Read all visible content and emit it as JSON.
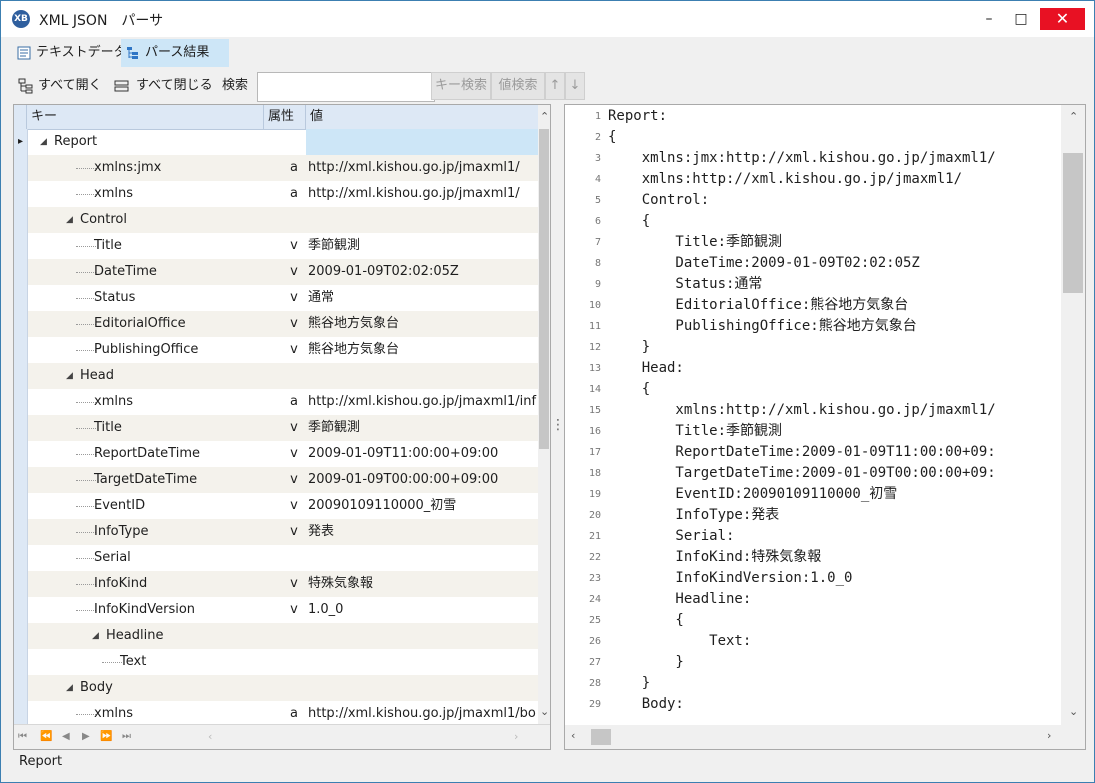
{
  "window": {
    "icon_text": "XB",
    "title": "XML JSON　パーサ",
    "minimize": "–",
    "maximize": "□",
    "close": "✕"
  },
  "tabs": [
    {
      "label": "テキストデータ",
      "icon": "document-icon",
      "selected": false
    },
    {
      "label": "パース結果",
      "icon": "tree-icon",
      "selected": true
    }
  ],
  "toolbar": {
    "expand_all": "すべて開く",
    "collapse_all": "すべて閉じる",
    "search_label": "検索",
    "search_value": "",
    "key_search": "キー検索",
    "value_search": "値検索",
    "up": "↑",
    "down": "↓"
  },
  "grid": {
    "columns": [
      "キー",
      "属性",
      "値"
    ],
    "rows": [
      {
        "key": "Report",
        "attr": "",
        "value": ""
      },
      {
        "key": "xmlns:jmx",
        "attr": "a",
        "value": "http://xml.kishou.go.jp/jmaxml1/"
      },
      {
        "key": "xmlns",
        "attr": "a",
        "value": "http://xml.kishou.go.jp/jmaxml1/"
      },
      {
        "key": "Control",
        "attr": "",
        "value": ""
      },
      {
        "key": "Title",
        "attr": "v",
        "value": "季節観測"
      },
      {
        "key": "DateTime",
        "attr": "v",
        "value": "2009-01-09T02:02:05Z"
      },
      {
        "key": "Status",
        "attr": "v",
        "value": "通常"
      },
      {
        "key": "EditorialOffice",
        "attr": "v",
        "value": "熊谷地方気象台"
      },
      {
        "key": "PublishingOffice",
        "attr": "v",
        "value": "熊谷地方気象台"
      },
      {
        "key": "Head",
        "attr": "",
        "value": ""
      },
      {
        "key": "xmlns",
        "attr": "a",
        "value": "http://xml.kishou.go.jp/jmaxml1/inf"
      },
      {
        "key": "Title",
        "attr": "v",
        "value": "季節観測"
      },
      {
        "key": "ReportDateTime",
        "attr": "v",
        "value": "2009-01-09T11:00:00+09:00"
      },
      {
        "key": "TargetDateTime",
        "attr": "v",
        "value": "2009-01-09T00:00:00+09:00"
      },
      {
        "key": "EventID",
        "attr": "v",
        "value": "20090109110000_初雪"
      },
      {
        "key": "InfoType",
        "attr": "v",
        "value": "発表"
      },
      {
        "key": "Serial",
        "attr": "",
        "value": ""
      },
      {
        "key": "InfoKind",
        "attr": "v",
        "value": "特殊気象報"
      },
      {
        "key": "InfoKindVersion",
        "attr": "v",
        "value": "1.0_0"
      },
      {
        "key": "Headline",
        "attr": "",
        "value": ""
      },
      {
        "key": "Text",
        "attr": "",
        "value": ""
      },
      {
        "key": "Body",
        "attr": "",
        "value": ""
      },
      {
        "key": "xmlns",
        "attr": "a",
        "value": "http://xml.kishou.go.jp/jmaxml1/bo"
      }
    ],
    "nav": [
      "⏮",
      "⏪",
      "◀",
      "▶",
      "⏩",
      "⏭"
    ]
  },
  "code": {
    "lines": [
      "Report:",
      "{",
      "    xmlns:jmx:http://xml.kishou.go.jp/jmaxml1/",
      "    xmlns:http://xml.kishou.go.jp/jmaxml1/",
      "    Control:",
      "    {",
      "        Title:季節観測",
      "        DateTime:2009-01-09T02:02:05Z",
      "        Status:通常",
      "        EditorialOffice:熊谷地方気象台",
      "        PublishingOffice:熊谷地方気象台",
      "    }",
      "    Head:",
      "    {",
      "        xmlns:http://xml.kishou.go.jp/jmaxml1/",
      "        Title:季節観測",
      "        ReportDateTime:2009-01-09T11:00:00+09:",
      "        TargetDateTime:2009-01-09T00:00:00+09:",
      "        EventID:20090109110000_初雪",
      "        InfoType:発表",
      "        Serial:",
      "        InfoKind:特殊気象報",
      "        InfoKindVersion:1.0_0",
      "        Headline:",
      "        {",
      "            Text:",
      "        }",
      "    }",
      "    Body:"
    ]
  },
  "status": {
    "text": "Report"
  }
}
